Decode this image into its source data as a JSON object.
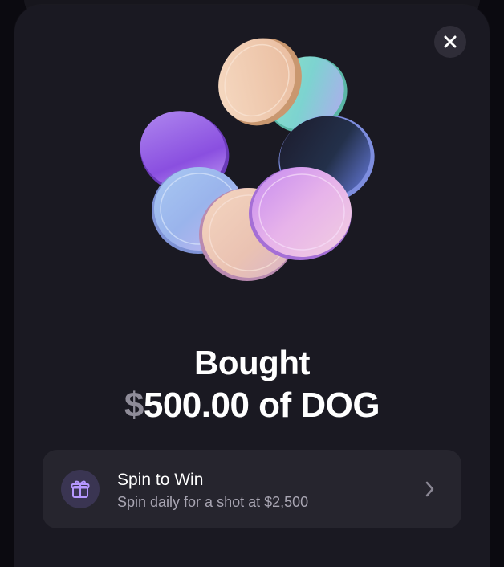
{
  "dialog": {
    "close_icon": "close-icon",
    "hero_image": "coins-illustration"
  },
  "confirmation": {
    "title": "Bought",
    "currency_symbol": "$",
    "amount_text": "500.00 of DOG"
  },
  "promo": {
    "icon": "gift-icon",
    "title": "Spin to Win",
    "subtitle": "Spin daily for a shot at $2,500",
    "chevron_icon": "chevron-right-icon"
  },
  "colors": {
    "background": "#0b0a10",
    "sheet": "#1a1922",
    "card": "#26252e",
    "accent": "#a88cff",
    "muted_text": "#a8a5b2"
  }
}
